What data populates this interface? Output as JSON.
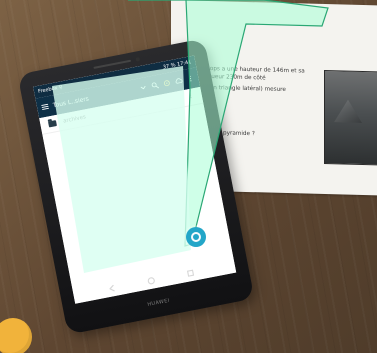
{
  "phone": {
    "status_left": "Freebox ⚲",
    "status_right": "37 % 17:41",
    "title": "Tous L..siers",
    "folder_label": "archives",
    "brand": "HUAWEI"
  },
  "paper": {
    "line1": "Khéops a une hauteur de 146m et sa",
    "line2": "longueur 230m de côté",
    "line3": "n d'un triangle latéral) mesure",
    "line4": "pyramide ?"
  },
  "colors": {
    "phone_header": "#0e3047",
    "screen_tint": "#d7f3ea",
    "pointer_ring": "#23a6c8",
    "accent_orange": "#f1b33b"
  }
}
